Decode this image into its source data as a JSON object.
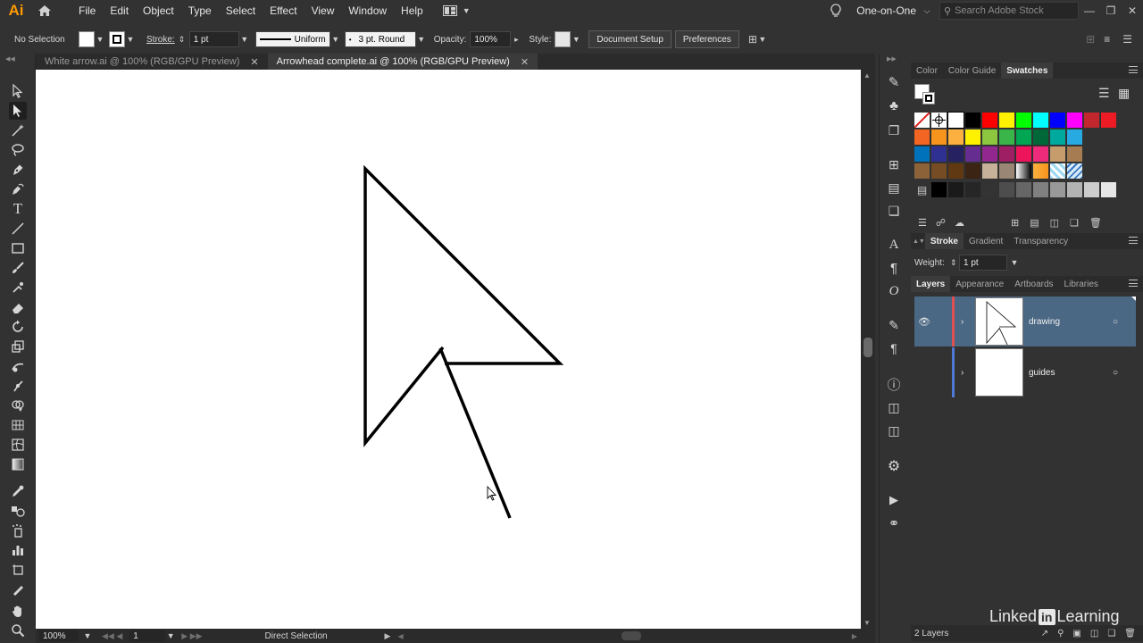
{
  "menubar": {
    "logo": "Ai",
    "items": [
      "File",
      "Edit",
      "Object",
      "Type",
      "Select",
      "Effect",
      "View",
      "Window",
      "Help"
    ],
    "workspace": "One-on-One",
    "search_placeholder": "Search Adobe Stock"
  },
  "control": {
    "selection": "No Selection",
    "stroke_label": "Stroke:",
    "stroke_value": "1 pt",
    "profile": "Uniform",
    "brush": "3 pt. Round",
    "opacity_label": "Opacity:",
    "opacity_value": "100%",
    "style_label": "Style:",
    "document_setup": "Document Setup",
    "preferences": "Preferences"
  },
  "tabs": [
    {
      "label": "White arrow.ai @ 100% (RGB/GPU Preview)",
      "active": false
    },
    {
      "label": "Arrowhead complete.ai @ 100% (RGB/GPU Preview)",
      "active": true
    }
  ],
  "status": {
    "zoom": "100%",
    "artboard": "1",
    "tool": "Direct Selection"
  },
  "swatches_panel": {
    "tabs": [
      "Color",
      "Color Guide",
      "Swatches"
    ],
    "active_tab": "Swatches",
    "rows": [
      [
        "#ff0000",
        "#fff200",
        "#00a651",
        "#00ffff",
        "#0000ff",
        "#ff00ff",
        "#ed1c24",
        "#f7941d",
        "#fff200"
      ],
      [
        "#f26522",
        "#f7941d",
        "#fbb040",
        "#fff200",
        "#8dc63f",
        "#39b54a",
        "#00a651",
        "#006838",
        "#00a99d",
        "#27aae1"
      ],
      [
        "#0072bc",
        "#2e3192",
        "#262262",
        "#662d91",
        "#92278f",
        "#9e1f63",
        "#ed145b",
        "#ee2a7b",
        "#c69c6d",
        "#a67c52"
      ],
      [
        "#8c6239",
        "#754c24",
        "#603913",
        "#3c2415",
        "#c7b299",
        "#998675",
        "#736357",
        "#534741",
        "#42210b",
        "#a1887f"
      ]
    ],
    "grays": [
      "#000000",
      "#1a1a1a",
      "#262626",
      "#333333",
      "#4d4d4d",
      "#666666",
      "#808080",
      "#999999",
      "#b3b3b3",
      "#cccccc",
      "#e6e6e6"
    ]
  },
  "stroke_panel": {
    "tabs": [
      "Stroke",
      "Gradient",
      "Transparency"
    ],
    "weight_label": "Weight:",
    "weight_value": "1 pt"
  },
  "layers_panel": {
    "tabs": [
      "Layers",
      "Appearance",
      "Artboards",
      "Libraries"
    ],
    "layers": [
      {
        "name": "drawing",
        "color": "#e05050",
        "selected": true
      },
      {
        "name": "guides",
        "color": "#4f79d6",
        "selected": false
      }
    ],
    "count": "2 Layers"
  },
  "branding": {
    "text": "Linked",
    "in": "in",
    "suffix": "Learning"
  }
}
